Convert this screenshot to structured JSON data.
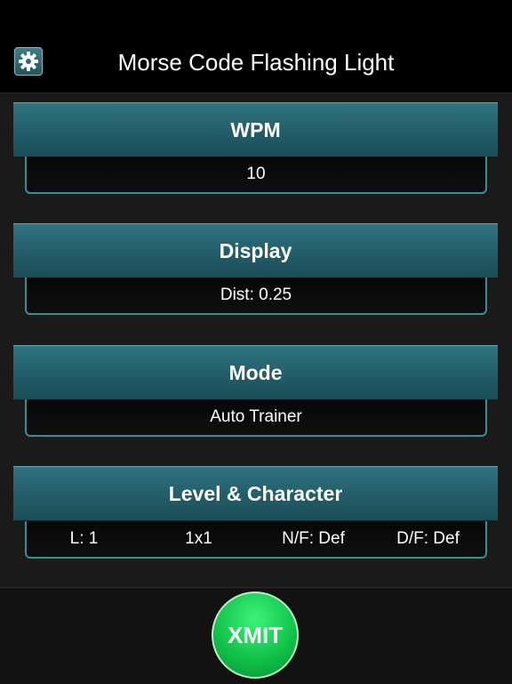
{
  "header": {
    "title": "Morse Code Flashing Light",
    "settings_icon": "gear-icon"
  },
  "sections": [
    {
      "label": "WPM",
      "value": "10"
    },
    {
      "label": "Display",
      "value": "Dist: 0.25"
    },
    {
      "label": "Mode",
      "value": "Auto Trainer"
    },
    {
      "label": "Level & Character",
      "values": [
        "L: 1",
        "1x1",
        "N/F: Def",
        "D/F: Def"
      ]
    }
  ],
  "transmit": {
    "label": "XMIT"
  },
  "colors": {
    "header_teal": "#2f7480",
    "border_teal": "#3d8b97",
    "xmit_green": "#12c44a"
  }
}
